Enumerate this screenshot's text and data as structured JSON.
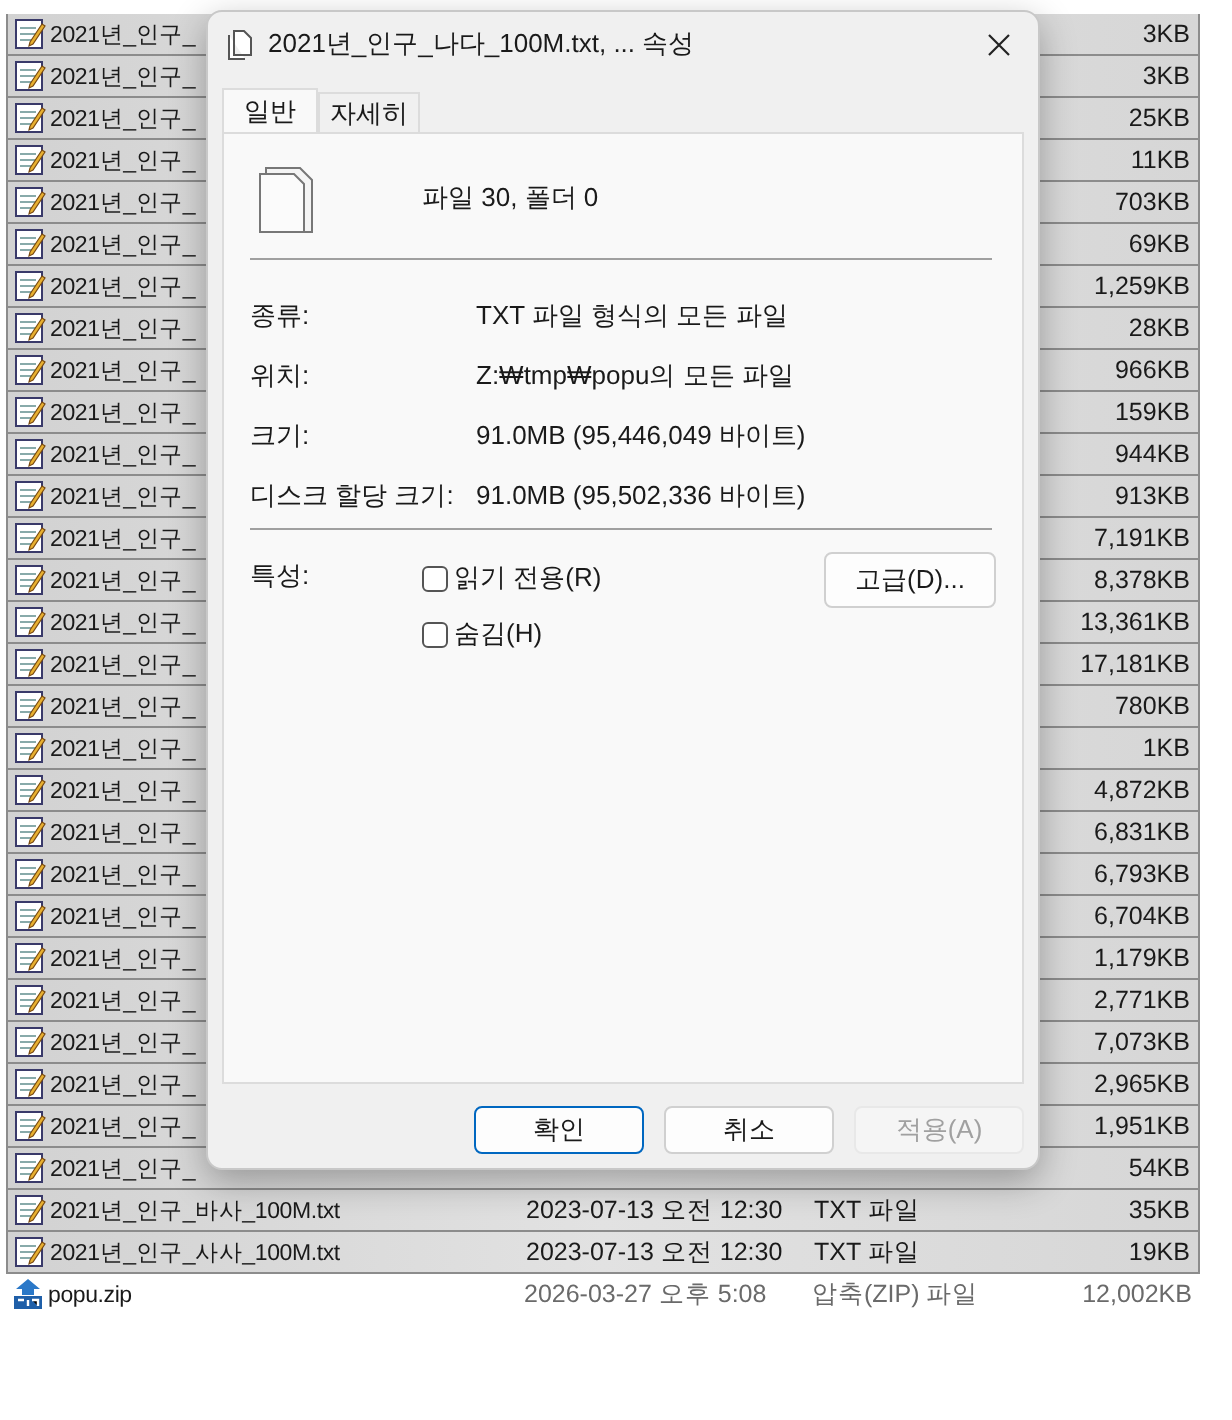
{
  "file_list": {
    "rows": [
      {
        "kind": "text",
        "name": "2021년_인구_",
        "size": "3KB",
        "selected": true
      },
      {
        "kind": "text",
        "name": "2021년_인구_",
        "size": "3KB",
        "selected": true
      },
      {
        "kind": "text",
        "name": "2021년_인구_",
        "size": "25KB",
        "selected": true
      },
      {
        "kind": "text",
        "name": "2021년_인구_",
        "size": "11KB",
        "selected": true
      },
      {
        "kind": "text",
        "name": "2021년_인구_",
        "size": "703KB",
        "selected": true
      },
      {
        "kind": "text",
        "name": "2021년_인구_",
        "size": "69KB",
        "selected": true
      },
      {
        "kind": "text",
        "name": "2021년_인구_",
        "size": "1,259KB",
        "selected": true
      },
      {
        "kind": "text",
        "name": "2021년_인구_",
        "size": "28KB",
        "selected": true
      },
      {
        "kind": "text",
        "name": "2021년_인구_",
        "size": "966KB",
        "selected": true
      },
      {
        "kind": "text",
        "name": "2021년_인구_",
        "size": "159KB",
        "selected": true
      },
      {
        "kind": "text",
        "name": "2021년_인구_",
        "size": "944KB",
        "selected": true
      },
      {
        "kind": "text",
        "name": "2021년_인구_",
        "size": "913KB",
        "selected": true
      },
      {
        "kind": "text",
        "name": "2021년_인구_",
        "size": "7,191KB",
        "selected": true
      },
      {
        "kind": "text",
        "name": "2021년_인구_",
        "size": "8,378KB",
        "selected": true
      },
      {
        "kind": "text",
        "name": "2021년_인구_",
        "size": "13,361KB",
        "selected": true
      },
      {
        "kind": "text",
        "name": "2021년_인구_",
        "size": "17,181KB",
        "selected": true
      },
      {
        "kind": "text",
        "name": "2021년_인구_",
        "size": "780KB",
        "selected": true
      },
      {
        "kind": "text",
        "name": "2021년_인구_",
        "size": "1KB",
        "selected": true
      },
      {
        "kind": "text",
        "name": "2021년_인구_",
        "size": "4,872KB",
        "selected": true
      },
      {
        "kind": "text",
        "name": "2021년_인구_",
        "size": "6,831KB",
        "selected": true
      },
      {
        "kind": "text",
        "name": "2021년_인구_",
        "size": "6,793KB",
        "selected": true
      },
      {
        "kind": "text",
        "name": "2021년_인구_",
        "size": "6,704KB",
        "selected": true
      },
      {
        "kind": "text",
        "name": "2021년_인구_",
        "size": "1,179KB",
        "selected": true
      },
      {
        "kind": "text",
        "name": "2021년_인구_",
        "size": "2,771KB",
        "selected": true
      },
      {
        "kind": "text",
        "name": "2021년_인구_",
        "size": "7,073KB",
        "selected": true
      },
      {
        "kind": "text",
        "name": "2021년_인구_",
        "size": "2,965KB",
        "selected": true
      },
      {
        "kind": "text",
        "name": "2021년_인구_",
        "size": "1,951KB",
        "selected": true
      },
      {
        "kind": "text",
        "name": "2021년_인구_",
        "size": "54KB",
        "selected": true
      },
      {
        "kind": "text",
        "name": "2021년_인구_바사_100M.txt",
        "date": "2023-07-13 오전 12:30",
        "type": "TXT 파일",
        "size": "35KB",
        "selected": true
      },
      {
        "kind": "text",
        "name": "2021년_인구_사사_100M.txt",
        "date": "2023-07-13 오전 12:30",
        "type": "TXT 파일",
        "size": "19KB",
        "selected": true
      },
      {
        "kind": "zip",
        "name": "popu.zip",
        "date": "2026-03-27 오후 5:08",
        "type": "압축(ZIP) 파일",
        "size": "12,002KB",
        "selected": false
      }
    ]
  },
  "dialog": {
    "title": "2021년_인구_나다_100M.txt, ... 속성",
    "tabs": [
      {
        "label": "일반",
        "selected": true
      },
      {
        "label": "자세히",
        "selected": false
      }
    ],
    "summary": "파일 30, 폴더 0",
    "properties": [
      {
        "label": "종류:",
        "value": "TXT 파일 형식의 모든 파일"
      },
      {
        "label": "위치:",
        "value": "Z:₩tmp₩popu의 모든 파일"
      },
      {
        "label": "크기:",
        "value": "91.0MB (95,446,049 바이트)"
      },
      {
        "label": "디스크 할당 크기:",
        "value": "91.0MB (95,502,336 바이트)"
      }
    ],
    "attributes_label": "특성:",
    "attributes": [
      {
        "label": "읽기 전용(R)",
        "checked": false
      },
      {
        "label": "숨김(H)",
        "checked": false
      }
    ],
    "advanced_button": "고급(D)...",
    "buttons": [
      {
        "label": "확인",
        "kind": "default",
        "disabled": false
      },
      {
        "label": "취소",
        "kind": "normal",
        "disabled": false
      },
      {
        "label": "적용(A)",
        "kind": "normal",
        "disabled": true
      }
    ]
  }
}
